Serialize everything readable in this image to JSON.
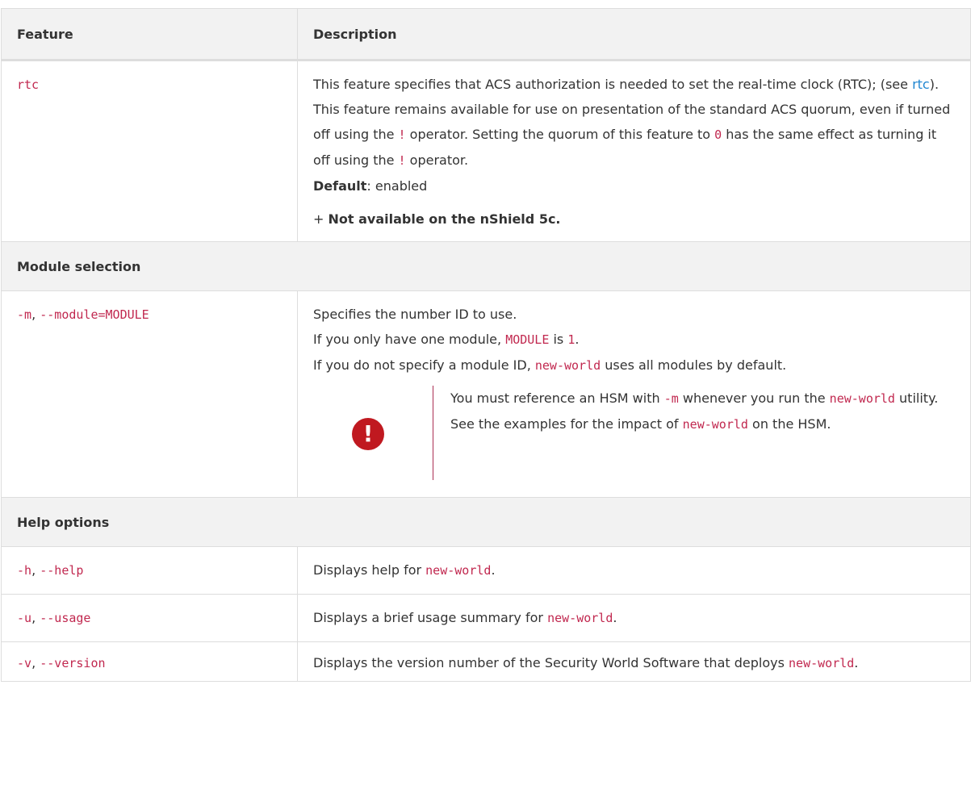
{
  "table": {
    "headers": {
      "feature": "Feature",
      "description": "Description"
    },
    "rtc_row": {
      "name": "rtc",
      "desc_part1": "This feature specifies that ACS authorization is needed to set the real-time clock (RTC); (see ",
      "link": "rtc",
      "desc_part2": "). This feature remains available for use on presentation of the standard ACS quorum, even if turned off using the ",
      "bang1": "!",
      "desc_part3": " operator. Setting the quorum of this feature to ",
      "zero": "0",
      "desc_part4": " has the same effect as turning it off using the ",
      "bang2": "!",
      "desc_part5": " operator.",
      "default_label": "Default",
      "default_value": ": enabled",
      "plus": "+ ",
      "note": "Not available on the nShield 5c."
    },
    "module_section": "Module selection",
    "module_row": {
      "opt_short": "-m",
      "sep": ", ",
      "opt_long": "--module=MODULE",
      "line1": "Specifies the number ID to use.",
      "line2_a": "If you only have one module, ",
      "line2_code": "MODULE",
      "line2_b": " is ",
      "line2_val": "1",
      "line2_c": ".",
      "line3_a": "If you do not specify a module ID, ",
      "line3_code": "new-world",
      "line3_b": " uses all modules by default.",
      "warning": {
        "icon_glyph": "!",
        "t1": "You must reference an HSM with ",
        "c1": "-m",
        "t2": " whenever you run the ",
        "c2": "new-world",
        "t3": " utility. See the examples for the impact of ",
        "c3": "new-world",
        "t4": " on the HSM."
      }
    },
    "help_section": "Help options",
    "help_rows": [
      {
        "short": "-h",
        "sep": ", ",
        "long": "--help",
        "desc": "Displays help for ",
        "code": "new-world",
        "end": "."
      },
      {
        "short": "-u",
        "sep": ", ",
        "long": "--usage",
        "desc": "Displays a brief usage summary for ",
        "code": "new-world",
        "end": "."
      },
      {
        "short": "-v",
        "sep": ", ",
        "long": "--version",
        "desc": "Displays the version number of the Security World Software that deploys ",
        "code": "new-world",
        "end": "."
      }
    ]
  },
  "colors": {
    "code": "#c1284f",
    "link": "#1f86d1",
    "warning": "#c01920",
    "header_bg": "#f2f2f2"
  }
}
